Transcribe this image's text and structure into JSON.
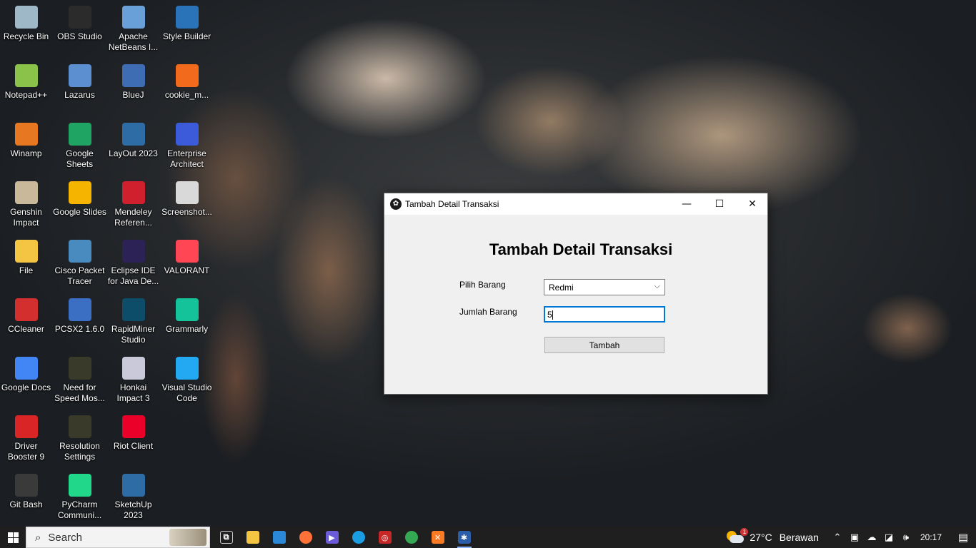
{
  "desktop": {
    "icons": [
      {
        "label": "Recycle Bin",
        "icon": "recycle-bin-icon",
        "color": "#9fb8c8"
      },
      {
        "label": "OBS Studio",
        "icon": "obs-studio-icon",
        "color": "#2b2b2b"
      },
      {
        "label": "Apache NetBeans I...",
        "icon": "netbeans-icon",
        "color": "#6aa0d8"
      },
      {
        "label": "Style Builder",
        "icon": "style-builder-icon",
        "color": "#2a73b8"
      },
      {
        "label": "Notepad++",
        "icon": "notepadpp-icon",
        "color": "#8bc34a"
      },
      {
        "label": "Lazarus",
        "icon": "lazarus-icon",
        "color": "#5b8fd0"
      },
      {
        "label": "BlueJ",
        "icon": "bluej-icon",
        "color": "#3f6db3"
      },
      {
        "label": "cookie_m...",
        "icon": "cookie-icon",
        "color": "#f26b1d"
      },
      {
        "label": "Winamp",
        "icon": "winamp-icon",
        "color": "#e87722"
      },
      {
        "label": "Google Sheets",
        "icon": "google-sheets-icon",
        "color": "#1fa463"
      },
      {
        "label": "LayOut 2023",
        "icon": "layout-icon",
        "color": "#2e6ca5"
      },
      {
        "label": "Enterprise Architect",
        "icon": "enterprise-architect-icon",
        "color": "#3b5bdb"
      },
      {
        "label": "Genshin Impact",
        "icon": "genshin-impact-icon",
        "color": "#c9b89a"
      },
      {
        "label": "Google Slides",
        "icon": "google-slides-icon",
        "color": "#f4b400"
      },
      {
        "label": "Mendeley Referen...",
        "icon": "mendeley-icon",
        "color": "#d0202e"
      },
      {
        "label": "Screenshot...",
        "icon": "screenshot-file-icon",
        "color": "#d9d9d9"
      },
      {
        "label": "File",
        "icon": "folder-icon",
        "color": "#f4c542"
      },
      {
        "label": "Cisco Packet Tracer",
        "icon": "packet-tracer-icon",
        "color": "#4a8bbf"
      },
      {
        "label": "Eclipse IDE for Java De...",
        "icon": "eclipse-icon",
        "color": "#2c2255"
      },
      {
        "label": "VALORANT",
        "icon": "valorant-icon",
        "color": "#ff4655"
      },
      {
        "label": "CCleaner",
        "icon": "ccleaner-icon",
        "color": "#d32f2f"
      },
      {
        "label": "PCSX2 1.6.0",
        "icon": "pcsx2-icon",
        "color": "#3a6fc4"
      },
      {
        "label": "RapidMiner Studio",
        "icon": "rapidminer-icon",
        "color": "#0e4d6a"
      },
      {
        "label": "Grammarly",
        "icon": "grammarly-icon",
        "color": "#15c39a"
      },
      {
        "label": "Google Docs",
        "icon": "google-docs-icon",
        "color": "#4285f4"
      },
      {
        "label": "Need for Speed Mos...",
        "icon": "nfs-icon",
        "color": "#3a3a2a"
      },
      {
        "label": "Honkai Impact 3",
        "icon": "honkai-icon",
        "color": "#c9c9d9"
      },
      {
        "label": "Visual Studio Code",
        "icon": "vscode-icon",
        "color": "#23a9f2"
      },
      {
        "label": "Driver Booster 9",
        "icon": "driver-booster-icon",
        "color": "#d92525"
      },
      {
        "label": "Resolution Settings",
        "icon": "resolution-settings-icon",
        "color": "#3a3a2a"
      },
      {
        "label": "Riot Client",
        "icon": "riot-client-icon",
        "color": "#eb0029"
      },
      {
        "label": "Git Bash",
        "icon": "git-bash-icon",
        "color": "#3a3a3a"
      },
      {
        "label": "PyCharm Communi...",
        "icon": "pycharm-icon",
        "color": "#21d789"
      },
      {
        "label": "SketchUp 2023",
        "icon": "sketchup-icon",
        "color": "#2e6ca5"
      }
    ]
  },
  "dialog": {
    "window_title": "Tambah Detail Transaksi",
    "heading": "Tambah Detail Transaksi",
    "pilih_label": "Pilih Barang",
    "pilih_value": "Redmi",
    "jumlah_label": "Jumlah Barang",
    "jumlah_value": "5",
    "submit_label": "Tambah",
    "min_glyph": "—",
    "max_glyph": "☐",
    "close_glyph": "✕"
  },
  "taskbar": {
    "search_placeholder": "Search",
    "apps": [
      {
        "icon": "task-view-icon",
        "color": "#1f1f1f",
        "glyph": "⧉"
      },
      {
        "icon": "file-explorer-icon",
        "color": "#f4c542",
        "glyph": ""
      },
      {
        "icon": "microsoft-store-icon",
        "color": "#2b88d8",
        "glyph": ""
      },
      {
        "icon": "firefox-icon",
        "color": "#ff7139",
        "glyph": ""
      },
      {
        "icon": "media-player-icon",
        "color": "#6b5bd6",
        "glyph": "▶"
      },
      {
        "icon": "edge-icon",
        "color": "#1b9de2",
        "glyph": ""
      },
      {
        "icon": "davinci-icon",
        "color": "#c62828",
        "glyph": "◎"
      },
      {
        "icon": "chrome-icon",
        "color": "#34a853",
        "glyph": ""
      },
      {
        "icon": "xampp-icon",
        "color": "#fb7a24",
        "glyph": "✕"
      },
      {
        "icon": "java-app-icon",
        "color": "#2a5ea8",
        "glyph": "✱"
      }
    ],
    "weather_temp": "27°C",
    "weather_desc": "Berawan",
    "weather_badge": "1",
    "time": "20:17"
  }
}
